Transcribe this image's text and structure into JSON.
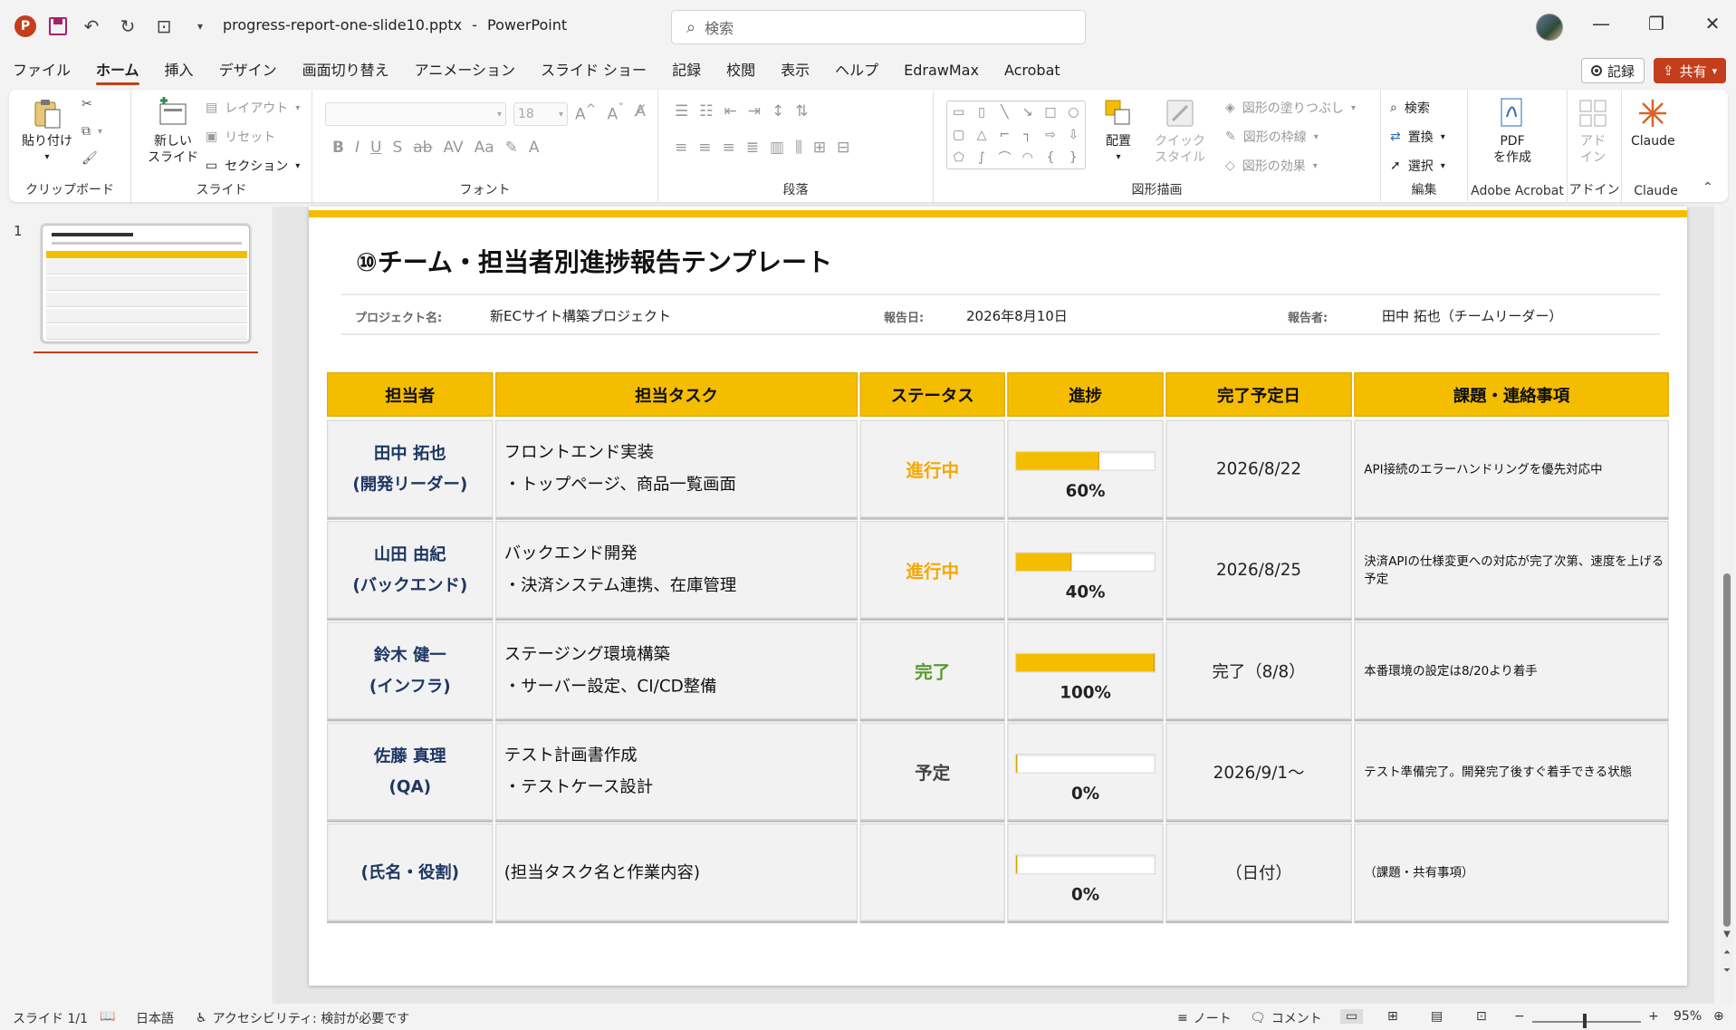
{
  "titlebar": {
    "app": "P",
    "filename": "progress-report-one-slide10.pptx",
    "separator": "-",
    "appname": "PowerPoint",
    "search_placeholder": "検索"
  },
  "menu": {
    "tabs": [
      "ファイル",
      "ホーム",
      "挿入",
      "デザイン",
      "画面切り替え",
      "アニメーション",
      "スライド ショー",
      "記録",
      "校閲",
      "表示",
      "ヘルプ",
      "EdrawMax",
      "Acrobat"
    ],
    "active": "ホーム",
    "record": "記録",
    "share": "共有"
  },
  "ribbon": {
    "clipboard": {
      "paste": "貼り付け",
      "label": "クリップボード"
    },
    "slides": {
      "new_slide_1": "新しい",
      "new_slide_2": "スライド",
      "layout": "レイアウト",
      "reset": "リセット",
      "section": "セクション",
      "label": "スライド"
    },
    "font": {
      "size": "18",
      "label": "フォント"
    },
    "paragraph": {
      "label": "段落"
    },
    "drawing": {
      "arrange": "配置",
      "quick_style_1": "クイック",
      "quick_style_2": "スタイル",
      "fill": "図形の塗りつぶし",
      "outline": "図形の枠線",
      "effects": "図形の効果",
      "label": "図形描画"
    },
    "editing": {
      "find": "検索",
      "replace": "置換",
      "select": "選択",
      "label": "編集"
    },
    "acrobat": {
      "pdf_1": "PDF",
      "pdf_2": "を作成",
      "label": "Adobe Acrobat"
    },
    "addin": {
      "btn_1": "アド",
      "btn_2": "イン",
      "label": "アドイン"
    },
    "claude": {
      "btn": "Claude",
      "label": "Claude"
    }
  },
  "slides_panel": {
    "slide_number": "1"
  },
  "slide": {
    "title": "⑩チーム・担当者別進捗報告テンプレート",
    "meta": {
      "project_label": "プロジェクト名:",
      "project_value": "新ECサイト構築プロジェクト",
      "date_label": "報告日:",
      "date_value": "2026年8月10日",
      "reporter_label": "報告者:",
      "reporter_value": "田中 拓也（チームリーダー）"
    },
    "headers": [
      "担当者",
      "担当タスク",
      "ステータス",
      "進捗",
      "完了予定日",
      "課題・連絡事項"
    ],
    "rows": [
      {
        "person_1": "田中 拓也",
        "person_2": "(開発リーダー)",
        "task_1": "フロントエンド実装",
        "task_2": "・トップページ、商品一覧画面",
        "status": "進行中",
        "status_color": "#f5a800",
        "progress": 0.6,
        "progress_label": "60%",
        "due": "2026/8/22",
        "issue": "API接続のエラーハンドリングを優先対応中"
      },
      {
        "person_1": "山田 由紀",
        "person_2": "(バックエンド)",
        "task_1": "バックエンド開発",
        "task_2": "・決済システム連携、在庫管理",
        "status": "進行中",
        "status_color": "#f5a800",
        "progress": 0.4,
        "progress_label": "40%",
        "due": "2026/8/25",
        "issue": "決済APIの仕様変更への対応が完了次第、速度を上げる予定"
      },
      {
        "person_1": "鈴木 健一",
        "person_2": "(インフラ)",
        "task_1": "ステージング環境構築",
        "task_2": "・サーバー設定、CI/CD整備",
        "status": "完了",
        "status_color": "#5a9a2e",
        "progress": 1.0,
        "progress_label": "100%",
        "due": "完了（8/8）",
        "issue": "本番環境の設定は8/20より着手"
      },
      {
        "person_1": "佐藤 真理",
        "person_2": "(QA)",
        "task_1": "テスト計画書作成",
        "task_2": "・テストケース設計",
        "status": "予定",
        "status_color": "#444444",
        "progress": 0.0,
        "progress_label": "0%",
        "due": "2026/9/1～",
        "issue": "テスト準備完了。開発完了後すぐ着手できる状態"
      },
      {
        "person_1": "(氏名・役割)",
        "person_2": "",
        "task_1": "(担当タスク名と作業内容)",
        "task_2": "",
        "status": "",
        "status_color": "#444444",
        "progress": 0.0,
        "progress_label": "0%",
        "due": "（日付）",
        "issue": "（課題・共有事項）"
      }
    ]
  },
  "statusbar": {
    "slide": "スライド 1/1",
    "language": "日本語",
    "accessibility": "アクセシビリティ: 検討が必要です",
    "notes": "ノート",
    "comments": "コメント",
    "zoom": "95%"
  }
}
